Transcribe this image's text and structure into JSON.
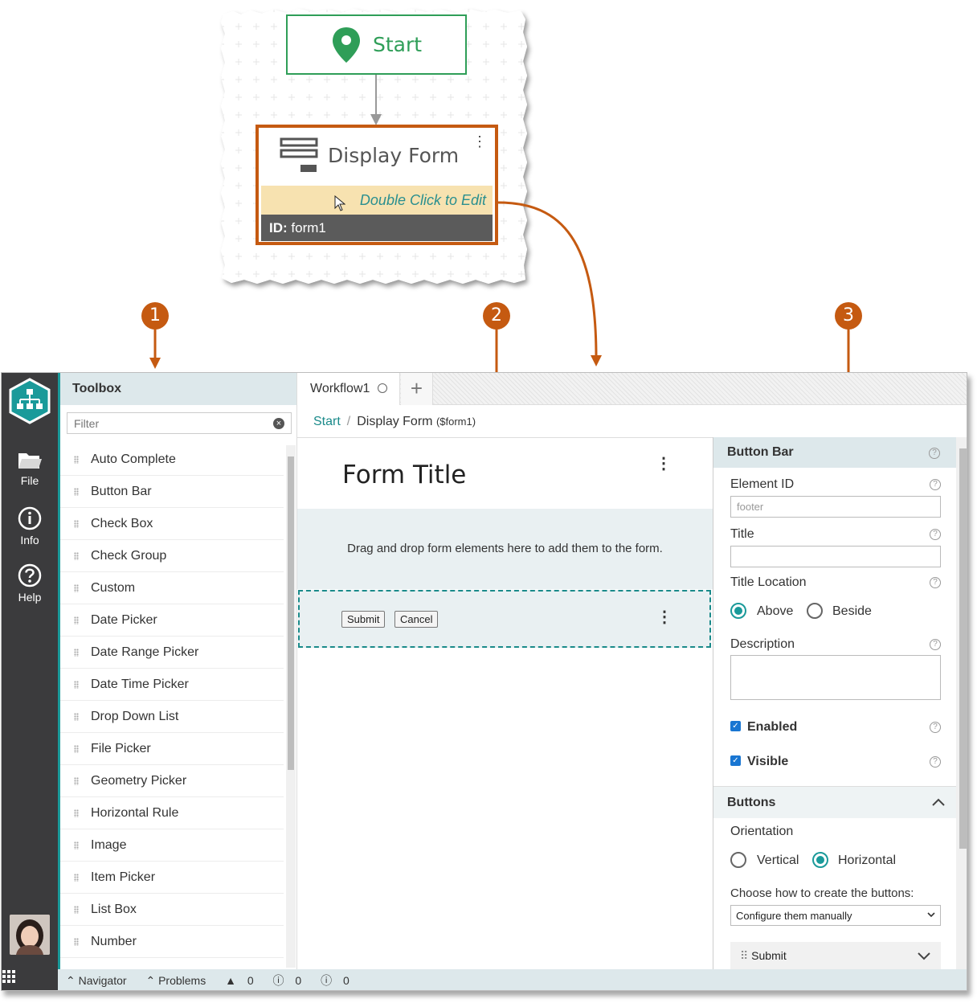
{
  "callout": {
    "start_label": "Start",
    "node_title": "Display Form",
    "node_edit_hint": "Double Click to Edit",
    "node_id_label": "ID:",
    "node_id_value": "form1",
    "markers": [
      "1",
      "2",
      "3"
    ],
    "accent_color": "#c55a11"
  },
  "nav": {
    "items": [
      {
        "label": "File",
        "icon": "folder-icon"
      },
      {
        "label": "Info",
        "icon": "info-icon"
      },
      {
        "label": "Help",
        "icon": "help-icon"
      }
    ]
  },
  "toolbox": {
    "title": "Toolbox",
    "filter_placeholder": "Filter",
    "items": [
      "Auto Complete",
      "Button Bar",
      "Check Box",
      "Check Group",
      "Custom",
      "Date Picker",
      "Date Range Picker",
      "Date Time Picker",
      "Drop Down List",
      "File Picker",
      "Geometry Picker",
      "Horizontal Rule",
      "Image",
      "Item Picker",
      "List Box",
      "Number"
    ]
  },
  "tabs": {
    "active": "Workflow1",
    "add": "+"
  },
  "breadcrumb": {
    "root": "Start",
    "separator": "/",
    "current": "Display Form",
    "current_id": "($form1)"
  },
  "canvas": {
    "form_title": "Form Title",
    "drop_hint": "Drag and drop form elements here to add them to the form.",
    "buttons": [
      "Submit",
      "Cancel"
    ]
  },
  "props": {
    "header": "Button Bar",
    "element_id_label": "Element ID",
    "element_id_value": "footer",
    "title_label": "Title",
    "title_location_label": "Title Location",
    "title_location_options": [
      "Above",
      "Beside"
    ],
    "title_location_selected": "Above",
    "description_label": "Description",
    "enabled_label": "Enabled",
    "visible_label": "Visible",
    "buttons_section": "Buttons",
    "orientation_label": "Orientation",
    "orientation_options": [
      "Vertical",
      "Horizontal"
    ],
    "orientation_selected": "Horizontal",
    "create_label": "Choose how to create the buttons:",
    "create_value": "Configure them manually",
    "button_item": "Submit"
  },
  "status": {
    "navigator": "Navigator",
    "problems": "Problems",
    "warnings": "0",
    "errors": "0",
    "infos": "0"
  },
  "colors": {
    "teal": "#1a9a9a",
    "green": "#2f9e58",
    "nav_bg": "#3b3b3d"
  }
}
